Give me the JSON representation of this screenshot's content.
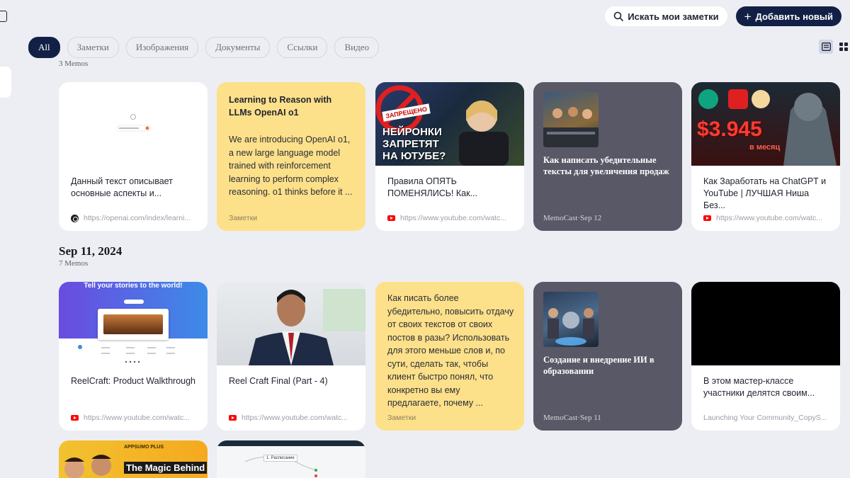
{
  "header": {
    "search_label": "Искать мои заметки",
    "add_label": "Добавить новый"
  },
  "filters": [
    "All",
    "Заметки",
    "Изображения",
    "Документы",
    "Ссылки",
    "Видео"
  ],
  "sections": [
    {
      "date": "",
      "count": "3 Memos",
      "cards": [
        {
          "title": "Данный текст описывает основные аспекты и...",
          "url": "https://openai.com/index/learni..."
        },
        {
          "title": "Learning to Reason with LLMs OpenAI o1",
          "body": "We are introducing OpenAI o1, a new large language model trained with reinforcement learning to perform complex reasoning. o1 thinks before it ...",
          "label": "Заметки"
        },
        {
          "title": "Правила ОПЯТЬ ПОМЕНЯЛИСЬ! Как...",
          "url": "https://www.youtube.com/watc...",
          "thumb_text": [
            "ЗАПРЕЩЕНО",
            "НЕЙРОНКИ",
            "ЗАПРЕТЯТ",
            "НА ЮТУБЕ?"
          ]
        },
        {
          "title": "Как написать убедительные тексты для увеличения продаж",
          "footer": "MemoCast·Sep 12"
        },
        {
          "title": "Как Заработать на ChatGPT и YouTube | ЛУЧШАЯ Ниша Без...",
          "url": "https://www.youtube.com/watc...",
          "thumb_text": [
            "$3.945",
            "в месяц"
          ]
        }
      ]
    },
    {
      "date": "Sep 11, 2024",
      "count": "7 Memos",
      "cards": [
        {
          "title": "ReelCraft: Product Walkthrough",
          "url": "https://www.youtube.com/watc...",
          "thumb_text": [
            "Tell your stories to the world!"
          ]
        },
        {
          "title": "Reel Craft Final (Part - 4)",
          "url": "https://www.youtube.com/watc..."
        },
        {
          "body": "Как писать более убедительно, повысить отдачу от своих текстов от своих постов в разы? Использовать для этого меньше слов и, по сути, сделать так, чтобы клиент быстро понял, что конкретно вы ему предлагаете, почему ...",
          "label": "Заметки"
        },
        {
          "title": "Создание и внедрение ИИ в образовании",
          "footer": "MemoCast·Sep 11"
        },
        {
          "title": "В этом мастер-классе участники делятся своим...",
          "url": "Launching Your Community_CopyS..."
        }
      ]
    },
    {
      "cards": [
        {
          "thumb_text": [
            "APPSUMO PLUS",
            "The Magic Behind"
          ]
        },
        {
          "thumb_text": [
            "1. Расписание"
          ]
        }
      ]
    }
  ]
}
